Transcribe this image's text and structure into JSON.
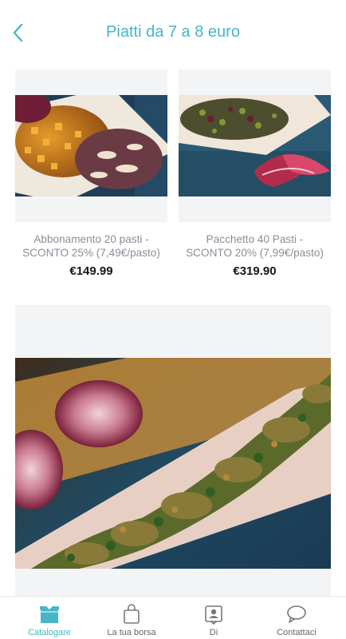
{
  "header": {
    "title": "Piatti da 7 a 8 euro",
    "back_icon": "chevron-left-icon"
  },
  "colors": {
    "accent": "#46b6c6",
    "card_bg": "#f3f4f6",
    "text_muted": "#8a8f96"
  },
  "products": [
    {
      "name": "Abbonamento 20 pasti - SCONTO 25% (7,49€/pasto)",
      "price": "€149.99"
    },
    {
      "name": "Pacchetto 40 Pasti - SCONTO 20% (7,99€/pasto)",
      "price": "€319.90"
    },
    {
      "name": "",
      "price": ""
    }
  ],
  "tabbar": {
    "items": [
      {
        "label": "Catalogare",
        "icon": "catalog-box-icon",
        "active": true
      },
      {
        "label": "La tua borsa",
        "icon": "shopping-bag-icon",
        "active": false
      },
      {
        "label": "Di",
        "icon": "profile-card-icon",
        "active": false
      },
      {
        "label": "Contattaci",
        "icon": "chat-bubble-icon",
        "active": false
      }
    ]
  }
}
